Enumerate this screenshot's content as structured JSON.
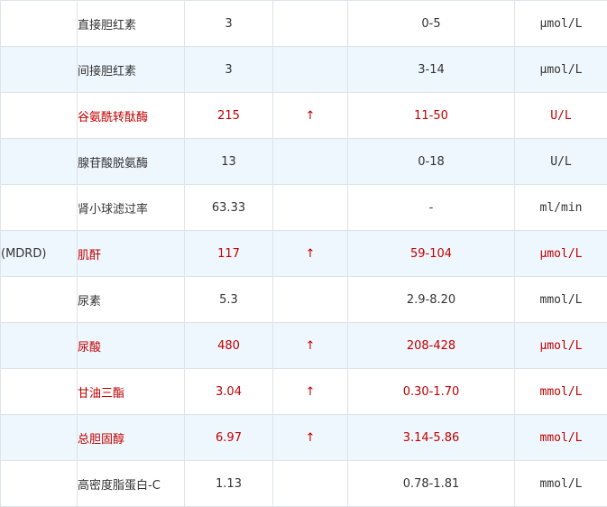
{
  "rows": [
    {
      "method": "",
      "name": "直接胆红素",
      "value": "3",
      "flag": "",
      "ref": "0-5",
      "unit": "μmol/L",
      "abnormal": false
    },
    {
      "method": "",
      "name": "间接胆红素",
      "value": "3",
      "flag": "",
      "ref": "3-14",
      "unit": "μmol/L",
      "abnormal": false
    },
    {
      "method": "",
      "name": "谷氨酰转酞酶",
      "value": "215",
      "flag": "↑",
      "ref": "11-50",
      "unit": "U/L",
      "abnormal": true
    },
    {
      "method": "",
      "name": "腺苷酸脱氨酶",
      "value": "13",
      "flag": "",
      "ref": "0-18",
      "unit": "U/L",
      "abnormal": false
    },
    {
      "method": "",
      "name": "肾小球滤过率",
      "value": "63.33",
      "flag": "",
      "ref": "-",
      "unit": "ml/min",
      "abnormal": false
    },
    {
      "method": "(MDRD)",
      "name": "肌酐",
      "value": "117",
      "flag": "↑",
      "ref": "59-104",
      "unit": "μmol/L",
      "abnormal": true
    },
    {
      "method": "",
      "name": "尿素",
      "value": "5.3",
      "flag": "",
      "ref": "2.9-8.20",
      "unit": "mmol/L",
      "abnormal": false
    },
    {
      "method": "",
      "name": "尿酸",
      "value": "480",
      "flag": "↑",
      "ref": "208-428",
      "unit": "μmol/L",
      "abnormal": true
    },
    {
      "method": "",
      "name": "甘油三酯",
      "value": "3.04",
      "flag": "↑",
      "ref": "0.30-1.70",
      "unit": "mmol/L",
      "abnormal": true
    },
    {
      "method": "",
      "name": "总胆固醇",
      "value": "6.97",
      "flag": "↑",
      "ref": "3.14-5.86",
      "unit": "mmol/L",
      "abnormal": true
    },
    {
      "method": "",
      "name": "高密度脂蛋白-C",
      "value": "1.13",
      "flag": "",
      "ref": "0.78-1.81",
      "unit": "mmol/L",
      "abnormal": false
    }
  ],
  "colors": {
    "abnormal_text": "#c00000",
    "normal_text": "#333333",
    "stripe_bg": "#eef7fd",
    "border": "#dde3ea"
  }
}
